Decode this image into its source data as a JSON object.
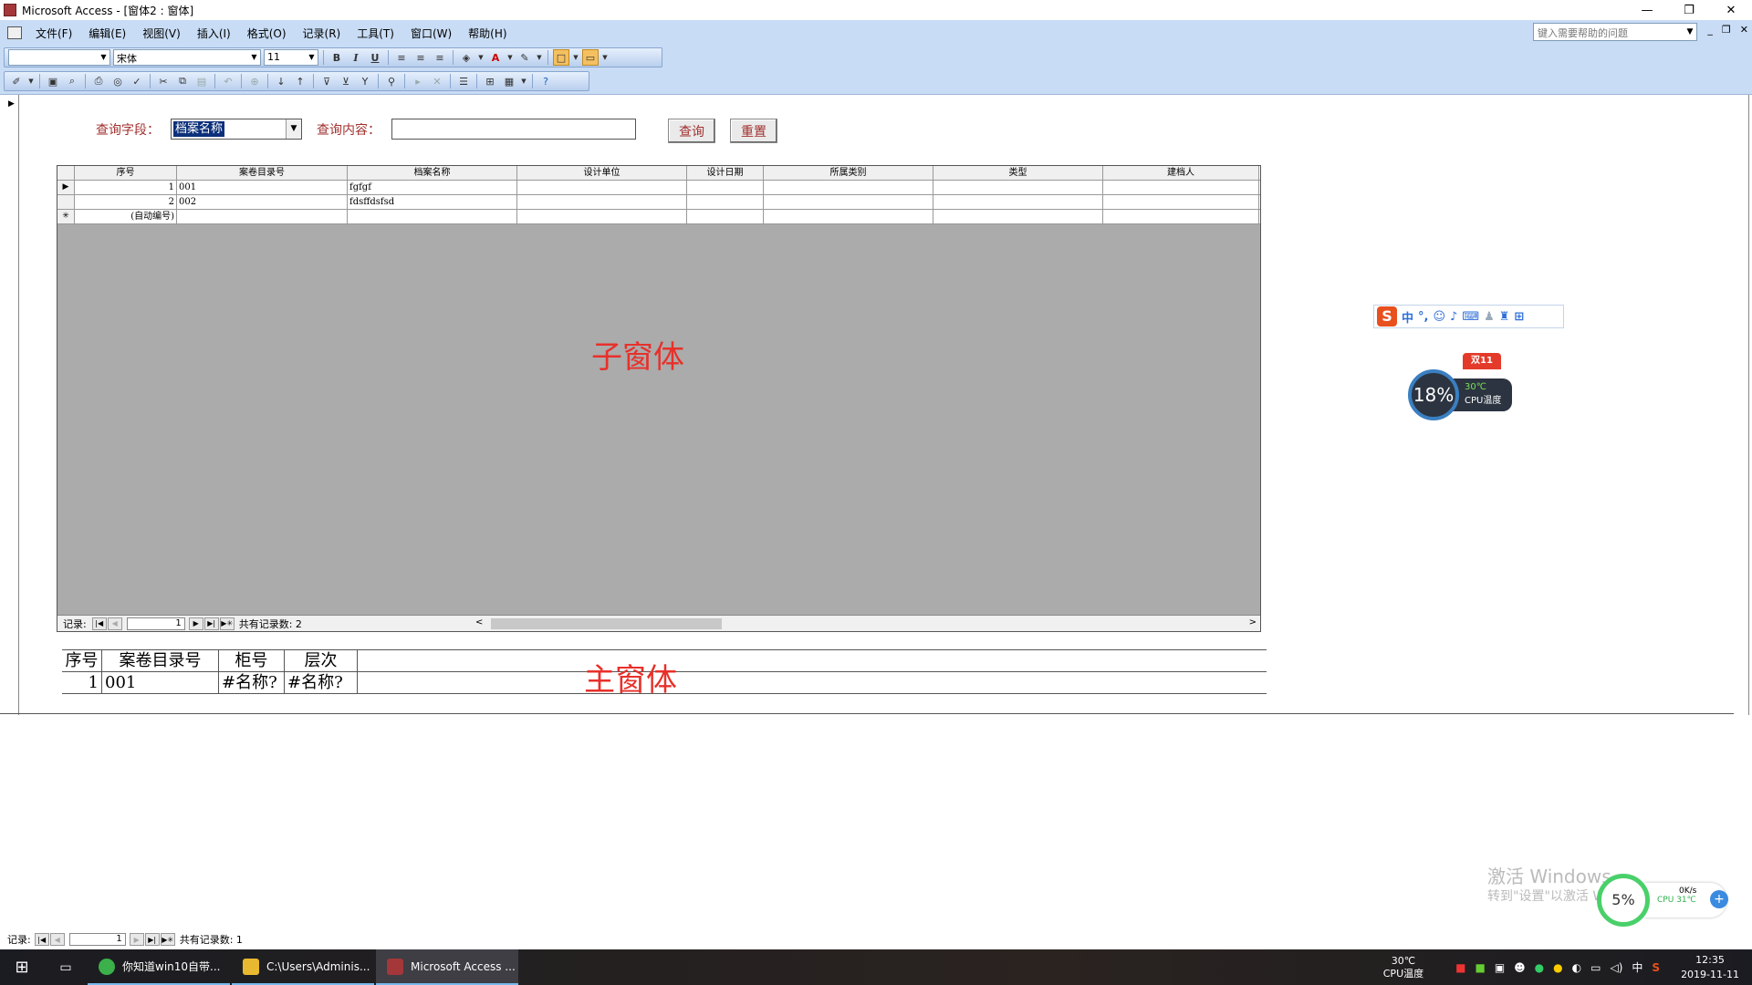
{
  "window": {
    "title": "Microsoft Access - [窗体2 : 窗体]",
    "controls": [
      "—",
      "❐",
      "✕"
    ]
  },
  "menu": {
    "items": [
      "文件(F)",
      "编辑(E)",
      "视图(V)",
      "插入(I)",
      "格式(O)",
      "记录(R)",
      "工具(T)",
      "窗口(W)",
      "帮助(H)"
    ],
    "help_placeholder": "键入需要帮助的问题",
    "mdi_controls": [
      "_",
      "❐",
      "✕"
    ]
  },
  "toolbar": {
    "object_combo": "",
    "font_name": "宋体",
    "font_size": "11",
    "bold": "B",
    "italic": "I",
    "underline": "U"
  },
  "query": {
    "field_label": "查询字段：",
    "field_value": "档案名称",
    "content_label": "查询内容：",
    "content_value": "",
    "search_button": "查询",
    "reset_button": "重置"
  },
  "subform": {
    "label": "子窗体",
    "columns": [
      "序号",
      "案卷目录号",
      "档案名称",
      "设计单位",
      "设计日期",
      "所属类别",
      "类型",
      "建档人"
    ],
    "rows": [
      {
        "selector": "▶",
        "seq": "1",
        "dir": "001",
        "name": "fgfgf",
        "unit": "",
        "date": "",
        "cat": "",
        "type": "",
        "person": ""
      },
      {
        "selector": "",
        "seq": "2",
        "dir": "002",
        "name": "fdsffdsfsd",
        "unit": "",
        "date": "",
        "cat": "",
        "type": "",
        "person": ""
      },
      {
        "selector": "✳",
        "seq": "(自动编号)",
        "dir": "",
        "name": "",
        "unit": "",
        "date": "",
        "cat": "",
        "type": "",
        "person": ""
      }
    ],
    "nav": {
      "label": "记录:",
      "current": "1",
      "total_text": "共有记录数: 2"
    }
  },
  "mainform": {
    "label": "主窗体",
    "columns": [
      "序号",
      "案卷目录号",
      "柜号",
      "层次"
    ],
    "row": {
      "seq": "1",
      "dir": "001",
      "cab": "#名称?",
      "layer": "#名称?"
    }
  },
  "status_nav": {
    "label": "记录:",
    "current": "1",
    "total_text": "共有记录数: 1"
  },
  "overlay": {
    "ime_mode": "中",
    "cpu_percent": "18%",
    "cpu_temp": "30℃",
    "cpu_temp_label": "CPU温度",
    "promo_badge": "双11",
    "watermark_title": "激活 Windows",
    "watermark_sub": "转到\"设置\"以激活 Windows。",
    "mem_percent": "5%",
    "net_speed": "0K/s",
    "cpu_small": "CPU 31℃"
  },
  "taskbar": {
    "tasks": [
      {
        "label": "你知道win10自带...",
        "color": "#3cb04a"
      },
      {
        "label": "C:\\Users\\Adminis...",
        "color": "#e8b830"
      },
      {
        "label": "Microsoft Access ...",
        "color": "#a4373a"
      }
    ],
    "cpu_temp": "30℃",
    "cpu_temp_label": "CPU温度",
    "ime": "中",
    "time": "12:35",
    "date": "2019-11-11"
  }
}
